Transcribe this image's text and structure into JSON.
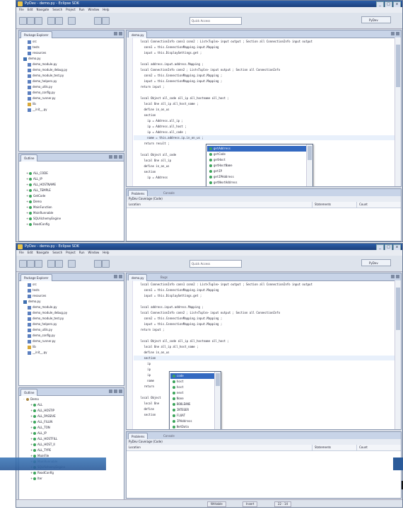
{
  "window": {
    "title": "PyDev - demo.py - Eclipse SDK",
    "menu": [
      "File",
      "Edit",
      "Navigate",
      "Search",
      "Project",
      "Run",
      "Window",
      "Help"
    ],
    "search_placeholder": "Quick Access",
    "perspective": "PyDev",
    "win_buttons": [
      "_",
      "□",
      "x"
    ]
  },
  "top": {
    "explorer": {
      "tab": "Package Explorer",
      "items": [
        {
          "label": "src",
          "icon": "folder-icon",
          "indent": 1
        },
        {
          "label": "tests",
          "icon": "folder-icon",
          "indent": 1
        },
        {
          "label": "resources",
          "icon": "folder-icon",
          "indent": 1
        },
        {
          "label": "demo.py",
          "icon": "project-icon",
          "indent": 0
        },
        {
          "label": "demo_module.py",
          "icon": "module-icon",
          "indent": 1
        },
        {
          "label": "demo_module_debug.py",
          "icon": "module-icon",
          "indent": 1
        },
        {
          "label": "demo_module_test.py",
          "icon": "module-icon",
          "indent": 1
        },
        {
          "label": "demo_helpers.py",
          "icon": "module-icon",
          "indent": 1
        },
        {
          "label": "demo_utils.py",
          "icon": "module-icon",
          "indent": 1
        },
        {
          "label": "demo_config.py",
          "icon": "module-icon",
          "indent": 1
        },
        {
          "label": "demo_runner.py",
          "icon": "module-icon",
          "indent": 1
        },
        {
          "label": "lib",
          "icon": "package-icon",
          "indent": 1
        },
        {
          "label": "__init__.py",
          "icon": "module-icon",
          "indent": 1
        }
      ]
    },
    "outline": {
      "tab": "Outline",
      "items": [
        "ALL_CODE",
        "ALL_IP",
        "ALL_HOSTNAME",
        "ALL_TEMPLE",
        "GetCode",
        "Demo",
        "MainFunction",
        "MainRunnable",
        "SQLAlchemyEngine",
        "ReadConfig"
      ]
    },
    "editor": {
      "tab": "demo.py",
      "lines": [
        "    local ConnectionInfo conn1 conn2 : List<Tuple> input output ; Section all ConnectionInfo input output",
        "      conn1 = this.ConnectionMapping.input.Mapping",
        "      input = this.DisplaySettings.get ;",
        "    ",
        "    local address.input.address.Mapping ;",
        "    local ConnectionInfo conn2 ; List<Tuple> input output ; Section all ConnectionInfo",
        "      conn2 = this.ConnectionMapping.input.Mapping ;",
        "      input = this.ConnectionMapping.input.Mapping ;",
        "    return input ;",
        "    ",
        "    local Object all_code all_ip all_hostname all_host ;",
        "      local One all_ip all_host_name ;",
        "      define in_on_us",
        "      section",
        "        ip = Address.all_ip ;",
        "        ip = Address.all_host ;",
        "        ip = Address.all_code ;",
        "        name = this.address.ip.in_on_us ;",
        "      return result ;",
        "    ",
        "    local Object all_code",
        "      local One all_ip",
        "      define in_on_us",
        "      section",
        "        ip = Address"
      ],
      "highlight_line": 17,
      "completion": [
        "getAddress",
        "getCode",
        "getHost",
        "getHostName",
        "getIP",
        "getIPAddress",
        "getNextAddress",
        "getName",
        "toString",
        "equals"
      ]
    },
    "bottom": {
      "tabs": [
        "Problems",
        "Console"
      ],
      "subheader": "PyDev Coverage (Code)",
      "columns": [
        "Location",
        "Statements",
        "Count"
      ]
    }
  },
  "bottom": {
    "explorer": {
      "tab": "Package Explorer",
      "items": [
        {
          "label": "src",
          "icon": "folder-icon",
          "indent": 1
        },
        {
          "label": "tests",
          "icon": "folder-icon",
          "indent": 1
        },
        {
          "label": "resources",
          "icon": "folder-icon",
          "indent": 1
        },
        {
          "label": "demo.py",
          "icon": "project-icon",
          "indent": 0
        },
        {
          "label": "demo_module.py",
          "icon": "module-icon",
          "indent": 1
        },
        {
          "label": "demo_module_debug.py",
          "icon": "module-icon",
          "indent": 1
        },
        {
          "label": "demo_module_test.py",
          "icon": "module-icon",
          "indent": 1
        },
        {
          "label": "demo_helpers.py",
          "icon": "module-icon",
          "indent": 1
        },
        {
          "label": "demo_utils.py",
          "icon": "module-icon",
          "indent": 1
        },
        {
          "label": "demo_config.py",
          "icon": "module-icon",
          "indent": 1
        },
        {
          "label": "demo_runner.py",
          "icon": "module-icon",
          "indent": 1
        },
        {
          "label": "lib",
          "icon": "package-icon",
          "indent": 1
        },
        {
          "label": "__init__.py",
          "icon": "module-icon",
          "indent": 1
        }
      ]
    },
    "outline": {
      "tab": "Outline",
      "root": "Demo",
      "items": [
        "ALL",
        "ALL_HOSTIP",
        "ALL_PASSIVE",
        "ALL_FILLIN",
        "ALL_TON",
        "ALL_IP",
        "ALL_HOSTFILL",
        "ALL_HOST_II",
        "ALL_TYPE",
        "MainFile",
        "MainRunnable",
        "SQLAlchemyEngine",
        "ReadConfig",
        "Iter"
      ]
    },
    "editor": {
      "tabs": [
        "demo.py",
        "Bugs"
      ],
      "lines": [
        "    local ConnectionInfo conn1 conn2 : List<Tuple> input output ; Section all ConnectionInfo input output",
        "      conn1 = this.ConnectionMapping.input.Mapping",
        "      input = this.DisplaySettings.get ;",
        "    ",
        "    local address.input.address.Mapping ;",
        "    local ConnectionInfo conn2 ; List<Tuple> input output ; Section all ConnectionInfo",
        "      conn2 = this.ConnectionMapping.input.Mapping ;",
        "      input = this.ConnectionMapping.input.Mapping ;",
        "    return input ;",
        "    ",
        "    local Object all_code all_ip all_hostname all_host ;",
        "      local One all_ip all_host_name ;",
        "      define in_on_us",
        "      section",
        "        ip",
        "        ip",
        "        ip",
        "        name",
        "      return",
        "    ",
        "    local Object",
        "      local One",
        "      define",
        "      section"
      ],
      "highlight_line": 13,
      "completion": [
        "code",
        "host",
        "host",
        "next",
        "None",
        "BOOLEANS",
        "INTEGER",
        "FLOAT",
        "IPAddress",
        "NetData"
      ]
    },
    "bottom": {
      "tabs": [
        "Problems",
        "Console"
      ],
      "subheader": "PyDev Coverage (Code)",
      "columns": [
        "Location",
        "Statements",
        "Count"
      ]
    },
    "status": [
      "Writable",
      "Insert",
      "22 : 14"
    ]
  },
  "colors": {
    "titlebar": "#2c5ea8",
    "selection": "#3369c1",
    "accent": "#3d78b8"
  }
}
